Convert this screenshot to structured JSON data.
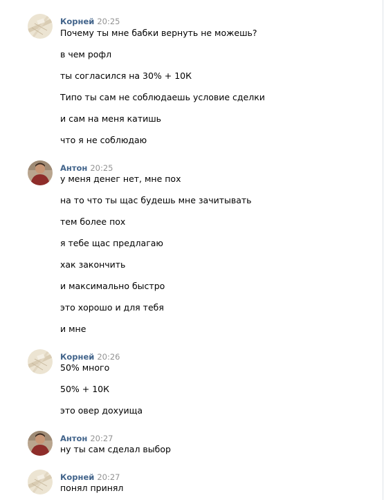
{
  "messages": [
    {
      "author": "Корней",
      "time": "20:25",
      "lines": [
        "Почему ты мне бабки вернуть не можешь?",
        "в чем рофл",
        "ты согласился на 30% + 10К",
        "Типо ты сам не соблюдаешь условие сделки",
        "и сам на меня катишь",
        "что я не соблюдаю"
      ]
    },
    {
      "author": "Антон",
      "time": "20:25",
      "lines": [
        "у меня денег нет, мне пох",
        "на то что ты щас будешь мне зачитывать",
        "тем более пох",
        "я тебе щас предлагаю",
        "хак закончить",
        "и максимально быстро",
        "это хорошо и для тебя",
        "и мне"
      ]
    },
    {
      "author": "Корней",
      "time": "20:26",
      "lines": [
        "50% много",
        "50% + 10К",
        "это овер дохуища"
      ]
    },
    {
      "author": "Антон",
      "time": "20:27",
      "lines": [
        "ну ты сам сделал выбор"
      ]
    },
    {
      "author": "Корней",
      "time": "20:27",
      "lines": [
        "понял принял"
      ]
    }
  ]
}
